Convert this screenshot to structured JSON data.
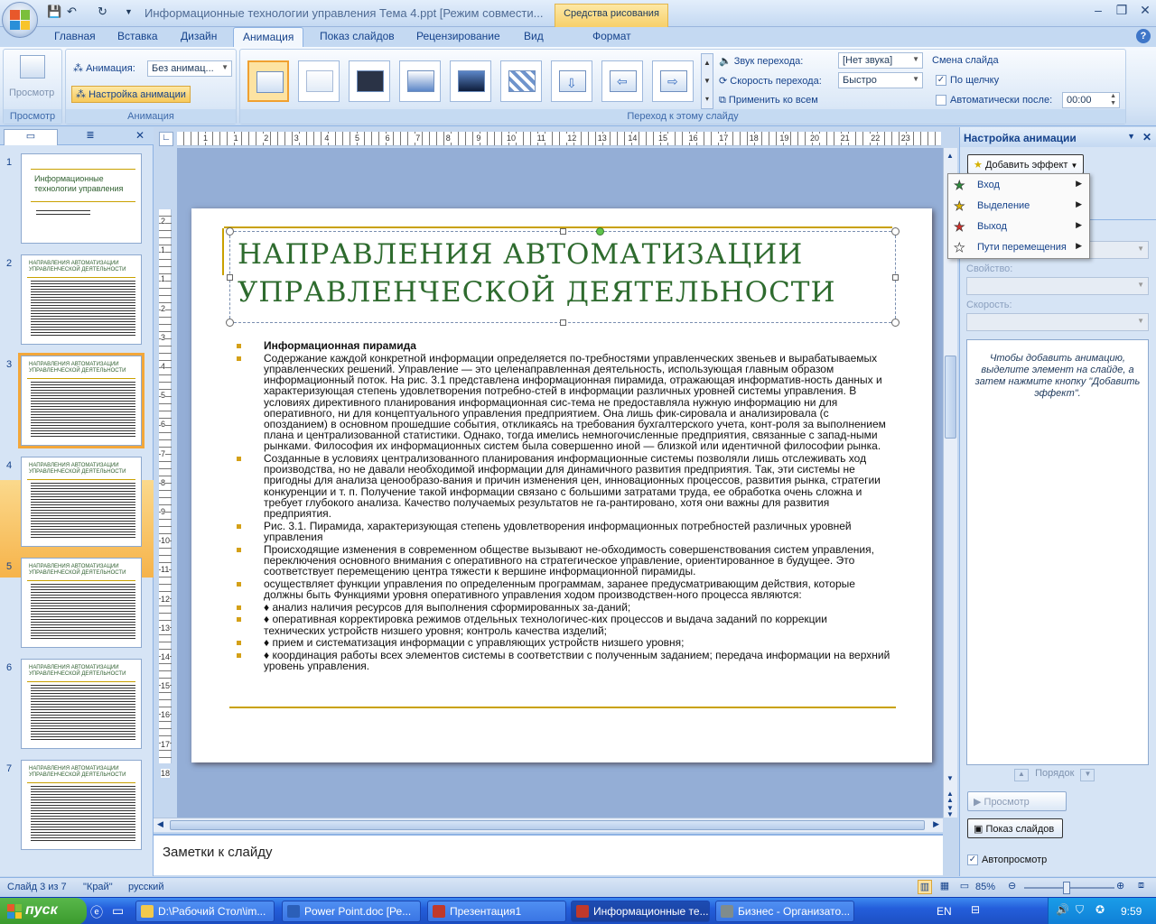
{
  "window": {
    "title": "Информационные технологии управления Тема 4.ppt [Режим совмести...",
    "context_tab": "Средства рисования"
  },
  "tabs": [
    {
      "label": "Главная"
    },
    {
      "label": "Вставка"
    },
    {
      "label": "Дизайн"
    },
    {
      "label": "Анимация"
    },
    {
      "label": "Показ слайдов"
    },
    {
      "label": "Рецензирование"
    },
    {
      "label": "Вид"
    },
    {
      "label": "Формат"
    }
  ],
  "ribbon": {
    "preview_label": "Просмотр",
    "preview_group": "Просмотр",
    "anim_label": "Анимация:",
    "anim_value": "Без анимац...",
    "custom_anim": "Настройка анимации",
    "anim_group": "Анимация",
    "transition_group": "Переход к этому слайду",
    "sound_label": "Звук перехода:",
    "sound_value": "[Нет звука]",
    "speed_label": "Скорость перехода:",
    "speed_value": "Быстро",
    "apply_all": "Применить ко всем",
    "advance_title": "Смена слайда",
    "on_click": "По щелчку",
    "on_click_checked": true,
    "auto_after": "Автоматически после:",
    "auto_time": "00:00"
  },
  "slides_panel": {
    "numbers": [
      "1",
      "2",
      "3",
      "4",
      "5",
      "6",
      "7"
    ],
    "first_title": "Информационные технологии управления",
    "other_title": "НАПРАВЛЕНИЯ АВТОМАТИЗАЦИИ УПРАВЛЕНЧЕСКОЙ ДЕЯТЕЛЬНОСТИ",
    "selected": 3
  },
  "ruler": {
    "h_labels": [
      "1",
      "1",
      "2",
      "3",
      "4",
      "5",
      "6",
      "7",
      "8",
      "9",
      "10",
      "11",
      "12",
      "13",
      "14",
      "15",
      "16",
      "17",
      "18",
      "19",
      "20",
      "21",
      "22",
      "23"
    ],
    "v_labels": [
      "2",
      "1",
      "1",
      "2",
      "3",
      "4",
      "5",
      "6",
      "7",
      "8",
      "9",
      "10",
      "11",
      "12",
      "13",
      "14",
      "15",
      "16",
      "17",
      "18"
    ]
  },
  "slide": {
    "title_line1": "НАПРАВЛЕНИЯ АВТОМАТИЗАЦИИ",
    "title_line2": "УПРАВЛЕНЧЕСКОЙ ДЕЯТЕЛЬНОСТИ",
    "bullets": [
      "Информационная пирамида",
      "Содержание каждой конкретной информации определяется по-требностями управленческих звеньев и вырабатываемых управленческих решений. Управление — это целенаправленная деятельность, использующая главным образом информационный поток. На рис. 3.1 представлена информационная пирамида, отражающая информатив-ность данных и характеризующая степень удовлетворения потребно-стей в информации различных уровней системы управления. В условиях директивного планирования информационная сис-тема не предоставляла нужную информацию ни для оперативного, ни для концептуального управления предприятием. Она лишь фик-сировала и анализировала (с опозданием) в основном прошедшие события, откликаясь на требования бухгалтерского учета, конт-роля за выполнением плана и централизованной статистики. Однако, тогда имелись немногочисленные предприятия, связанные с запад-ными рынками. Философия их информационных систем была совершенно иной — близкой или идентичной философии рынка.",
      "Созданные в условиях централизованного планирования информационные системы позволяли лишь отслеживать ход производства, но не давали необходимой информации для динамичного развития предприятия. Так, эти системы не пригодны для анализа ценообразо-вания и причин изменения цен, инновационных процессов, развития рынка, стратегии конкуренции и т. п. Получение такой информации связано с большими затратами труда, ее обработка очень сложна и требует глубокого анализа. Качество получаемых результатов не га-рантировано, хотя они важны для развития предприятия.",
      "Рис. 3.1. Пирамида, характеризующая степень удовлетворения информационных потребностей различных уровней управления",
      "Происходящие изменения в современном обществе вызывают не-обходимость совершенствования систем управления, переключения основного внимания с оперативного на стратегическое управление, ориентированное в будущее. Это соответствует перемещению центра тяжести к вершине информационной пирамиды.",
      "осуществляет функции управления по определенным программам, заранее предусматривающим действия, которые должны быть Функциями уровня оперативного управления ходом производствен-ного процесса являются:",
      "♦  анализ наличия ресурсов для выполнения сформированных за-даний;",
      "♦  оперативная корректировка режимов отдельных технологичес-ких процессов и выдача заданий по коррекции технических устройств низшего уровня; контроль качества изделий;",
      "♦  прием и систематизация информации с управляющих устройств низшего уровня;",
      "♦  координация работы всех элементов системы в соответствии с полученным заданием; передача информации на верхний уровень управления."
    ]
  },
  "notes": {
    "placeholder": "Заметки к слайду"
  },
  "taskpane": {
    "title": "Настройка анимации",
    "add_effect": "Добавить эффект",
    "menu": [
      {
        "label": "Вход",
        "icon": "entrance-star-icon",
        "color": "#2e8b3c"
      },
      {
        "label": "Выделение",
        "icon": "emphasis-star-icon",
        "color": "#e0b400"
      },
      {
        "label": "Выход",
        "icon": "exit-star-icon",
        "color": "#d0302a"
      },
      {
        "label": "Пути перемещения",
        "icon": "motion-path-star-icon",
        "color": "#ffffff"
      }
    ],
    "property_label": "Свойство:",
    "speed_label": "Скорость:",
    "info": "Чтобы добавить анимацию, выделите элемент на слайде, а затем нажмите кнопку \"Добавить эффект\".",
    "order_label": "Порядок",
    "preview_btn": "Просмотр",
    "slideshow_btn": "Показ слайдов",
    "autopreview": "Автопросмотр",
    "autopreview_checked": true
  },
  "statusbar": {
    "slide_info": "Слайд 3 из 7",
    "theme": "\"Край\"",
    "language": "русский",
    "zoom": "85%",
    "zoom_fraction": 0.85
  },
  "taskbar": {
    "start": "пуск",
    "items": [
      {
        "label": "D:\\Рабочий Стол\\im...",
        "color": "#f2c94c"
      },
      {
        "label": "Power Point.doc [Ре...",
        "color": "#2b5fb8"
      },
      {
        "label": "Презентация1",
        "color": "#c0392b"
      },
      {
        "label": "Информационные те...",
        "color": "#c0392b"
      },
      {
        "label": "Бизнес - Организато...",
        "color": "#7f8c8d"
      }
    ],
    "lang": "EN",
    "time": "9:59"
  }
}
